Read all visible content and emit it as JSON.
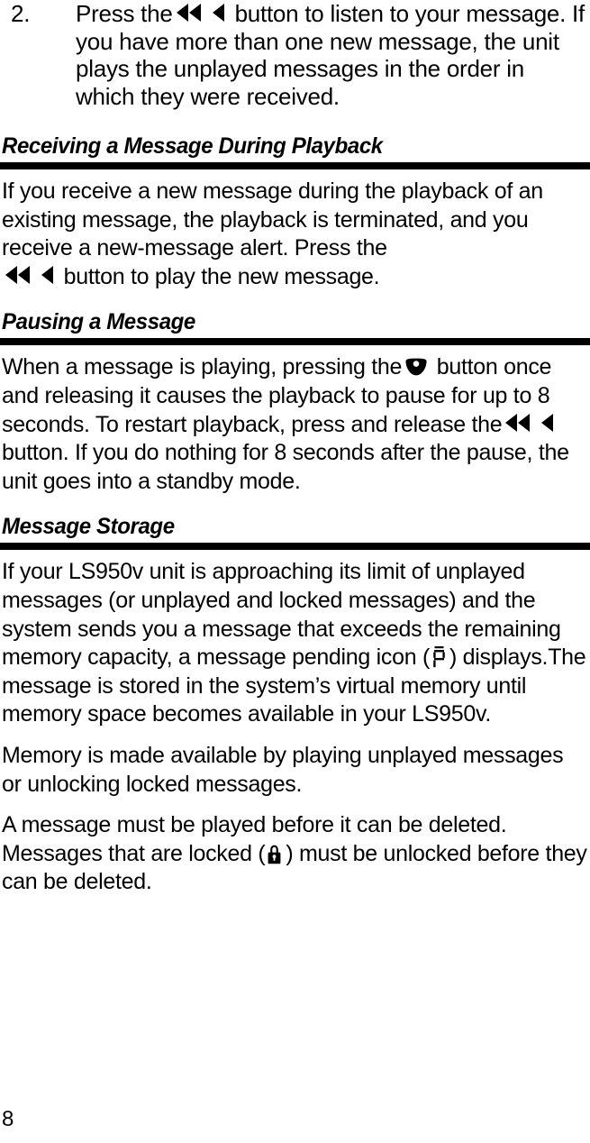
{
  "document": {
    "page_number": "8",
    "product_name": "LS950v"
  },
  "steps": [
    {
      "number": "2.",
      "text_before_icons": "Press the",
      "icons": [
        "rewind-icon",
        "previous-icon"
      ],
      "text_after_icons": "button to listen to your message. If you have more than one new message, the unit plays the unplayed messages in the order in which they were received."
    }
  ],
  "sections": [
    {
      "heading": "Receiving a Message During Playback",
      "paragraphs": [
        {
          "lead": "If you receive a new message during the playback of an existing message, the playback is terminated, and you receive a new-message alert. Press the",
          "icons": [
            "rewind-icon",
            "previous-icon"
          ],
          "tail": "button to play the new message."
        }
      ]
    },
    {
      "heading": "Pausing a Message",
      "paragraphs": [
        {
          "lead": "When a message is playing, pressing the",
          "icons": [
            "select-icon"
          ],
          "mid": "button once and releasing it causes the playback to pause for up to 8 seconds. To restart playback, press and release the",
          "icons2": [
            "rewind-icon",
            "previous-icon"
          ],
          "tail": "button. If you do nothing for 8 seconds after the pause, the unit goes into a standby mode."
        }
      ]
    },
    {
      "heading": "Message Storage",
      "paragraphs": [
        {
          "lead": "If your LS950v unit is approaching its limit of unplayed messages (or unplayed and locked messages) and the system sends you a message that exceeds the remaining memory capacity, a message pending icon (",
          "icons": [
            "message-pending-icon"
          ],
          "tail": ") displays.The message is stored in the system’s virtual memory until memory space becomes available in your LS950v."
        },
        {
          "lead": "Memory is made available by playing unplayed messages or unlocking locked messages."
        },
        {
          "lead": "A message must be played before it can be deleted. Messages that are locked (",
          "icons": [
            "lock-icon"
          ],
          "tail": ") must be unlocked before they can be deleted."
        }
      ]
    }
  ],
  "colors": {
    "text": "#000000",
    "rule": "#000000",
    "background": "#ffffff"
  }
}
